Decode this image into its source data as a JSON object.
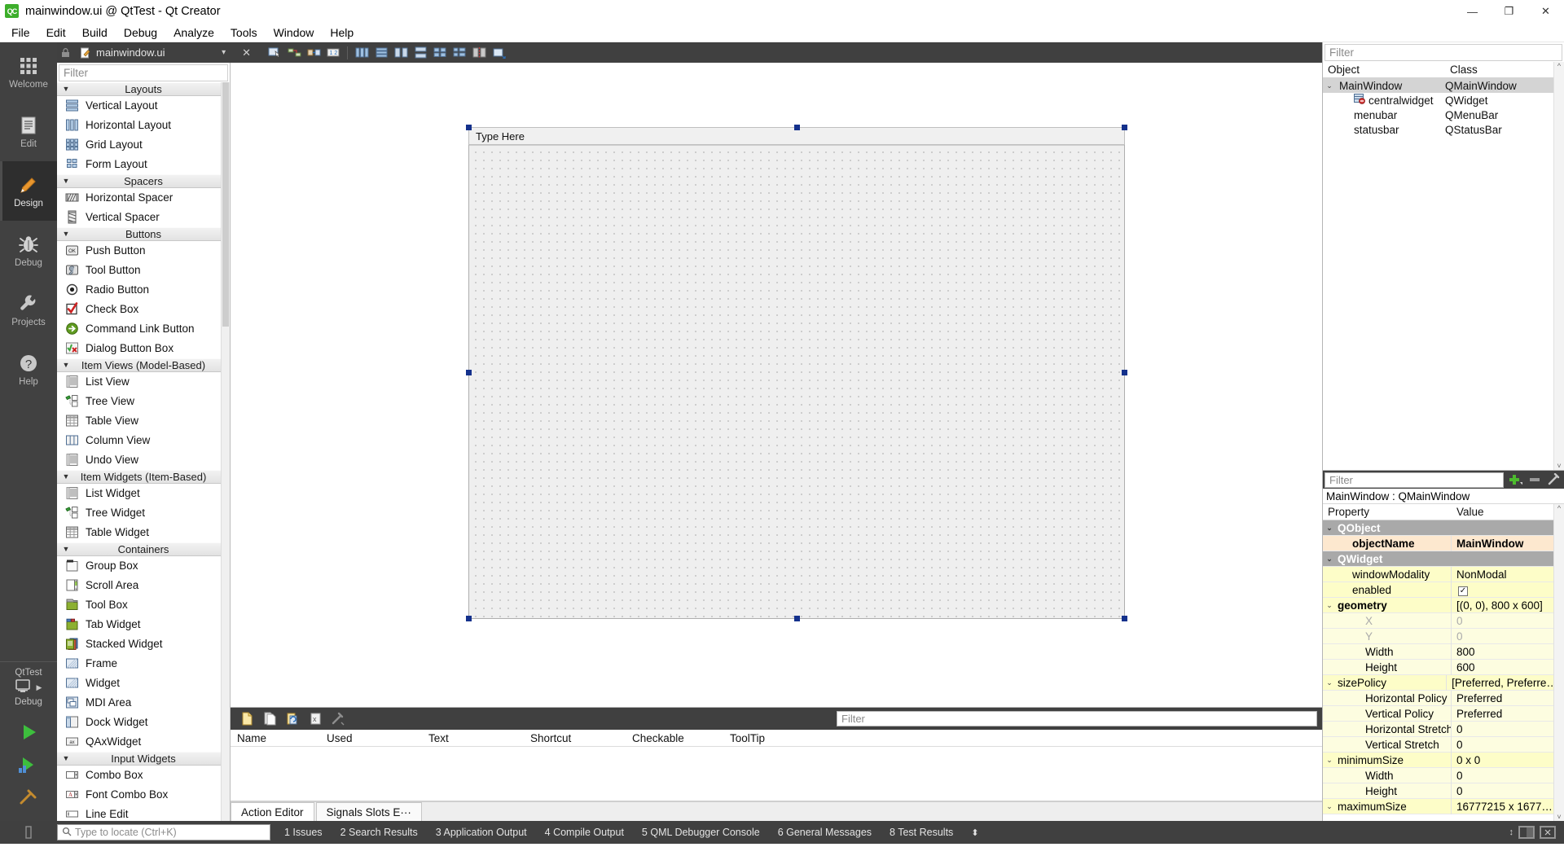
{
  "window": {
    "title": "mainwindow.ui @ QtTest - Qt Creator",
    "app_icon_label": "QC",
    "minimize": "—",
    "maximize": "❐",
    "close": "✕"
  },
  "menubar": {
    "items": [
      "File",
      "Edit",
      "Build",
      "Debug",
      "Analyze",
      "Tools",
      "Window",
      "Help"
    ]
  },
  "modebar": {
    "items": [
      {
        "label": "Welcome",
        "icon": "grid-icon",
        "active": false
      },
      {
        "label": "Edit",
        "icon": "document-icon",
        "active": false
      },
      {
        "label": "Design",
        "icon": "pencil-icon",
        "active": true
      },
      {
        "label": "Debug",
        "icon": "bug-icon",
        "active": false
      },
      {
        "label": "Projects",
        "icon": "wrench-icon",
        "active": false
      },
      {
        "label": "Help",
        "icon": "question-icon",
        "active": false
      }
    ],
    "kit": {
      "project": "QtTest",
      "config": "Debug"
    },
    "run_buttons": [
      "run-icon",
      "debug-run-icon",
      "build-icon"
    ]
  },
  "editor_tab": {
    "filename": "mainwindow.ui",
    "caret": "▾",
    "close": "✕",
    "toolbar_icons": [
      "edit-widgets-icon",
      "edit-signals-slots-icon",
      "edit-buddies-icon",
      "edit-tab-order-icon",
      "layout-horizontal-icon",
      "layout-vertical-icon",
      "layout-splitter-h-icon",
      "layout-splitter-v-icon",
      "layout-grid-icon",
      "layout-form-icon",
      "break-layout-icon",
      "adjust-size-icon"
    ]
  },
  "widget_box": {
    "filter_placeholder": "Filter",
    "categories": [
      {
        "name": "Layouts",
        "items": [
          {
            "label": "Vertical Layout",
            "icon": "vertical-layout-icon"
          },
          {
            "label": "Horizontal Layout",
            "icon": "horizontal-layout-icon"
          },
          {
            "label": "Grid Layout",
            "icon": "grid-layout-icon"
          },
          {
            "label": "Form Layout",
            "icon": "form-layout-icon"
          }
        ]
      },
      {
        "name": "Spacers",
        "items": [
          {
            "label": "Horizontal Spacer",
            "icon": "horizontal-spacer-icon"
          },
          {
            "label": "Vertical Spacer",
            "icon": "vertical-spacer-icon"
          }
        ]
      },
      {
        "name": "Buttons",
        "items": [
          {
            "label": "Push Button",
            "icon": "push-button-icon"
          },
          {
            "label": "Tool Button",
            "icon": "tool-button-icon"
          },
          {
            "label": "Radio Button",
            "icon": "radio-button-icon"
          },
          {
            "label": "Check Box",
            "icon": "check-box-icon"
          },
          {
            "label": "Command Link Button",
            "icon": "command-link-icon"
          },
          {
            "label": "Dialog Button Box",
            "icon": "dialog-button-box-icon"
          }
        ]
      },
      {
        "name": "Item Views (Model-Based)",
        "items": [
          {
            "label": "List View",
            "icon": "list-view-icon"
          },
          {
            "label": "Tree View",
            "icon": "tree-view-icon"
          },
          {
            "label": "Table View",
            "icon": "table-view-icon"
          },
          {
            "label": "Column View",
            "icon": "column-view-icon"
          },
          {
            "label": "Undo View",
            "icon": "undo-view-icon"
          }
        ]
      },
      {
        "name": "Item Widgets (Item-Based)",
        "items": [
          {
            "label": "List Widget",
            "icon": "list-widget-icon"
          },
          {
            "label": "Tree Widget",
            "icon": "tree-widget-icon"
          },
          {
            "label": "Table Widget",
            "icon": "table-widget-icon"
          }
        ]
      },
      {
        "name": "Containers",
        "items": [
          {
            "label": "Group Box",
            "icon": "group-box-icon"
          },
          {
            "label": "Scroll Area",
            "icon": "scroll-area-icon"
          },
          {
            "label": "Tool Box",
            "icon": "tool-box-icon"
          },
          {
            "label": "Tab Widget",
            "icon": "tab-widget-icon"
          },
          {
            "label": "Stacked Widget",
            "icon": "stacked-widget-icon"
          },
          {
            "label": "Frame",
            "icon": "frame-icon"
          },
          {
            "label": "Widget",
            "icon": "widget-icon"
          },
          {
            "label": "MDI Area",
            "icon": "mdi-area-icon"
          },
          {
            "label": "Dock Widget",
            "icon": "dock-widget-icon"
          },
          {
            "label": "QAxWidget",
            "icon": "qaxwidget-icon"
          }
        ]
      },
      {
        "name": "Input Widgets",
        "items": [
          {
            "label": "Combo Box",
            "icon": "combo-box-icon"
          },
          {
            "label": "Font Combo Box",
            "icon": "font-combo-box-icon"
          },
          {
            "label": "Line Edit",
            "icon": "line-edit-icon"
          }
        ]
      }
    ]
  },
  "form_canvas": {
    "menu_placeholder": "Type Here"
  },
  "action_editor": {
    "filter_placeholder": "Filter",
    "toolbar_icons": [
      "new-action-icon",
      "copy-action-icon",
      "paste-action-icon",
      "delete-action-icon",
      "configure-icon"
    ],
    "columns": [
      "Name",
      "Used",
      "Text",
      "Shortcut",
      "Checkable",
      "ToolTip"
    ],
    "rows": [],
    "tabs": [
      {
        "label": "Action Editor",
        "selected": true
      },
      {
        "label": "Signals  Slots E···",
        "selected": false
      }
    ]
  },
  "object_inspector": {
    "filter_placeholder": "Filter",
    "columns": [
      "Object",
      "Class"
    ],
    "rows": [
      {
        "object": "MainWindow",
        "class": "QMainWindow",
        "depth": 0,
        "twisty": "⌄",
        "selected": true,
        "icon": ""
      },
      {
        "object": "centralwidget",
        "class": "QWidget",
        "depth": 1,
        "twisty": "",
        "selected": false,
        "icon": "central-widget-icon"
      },
      {
        "object": "menubar",
        "class": "QMenuBar",
        "depth": 1,
        "twisty": "",
        "selected": false,
        "icon": ""
      },
      {
        "object": "statusbar",
        "class": "QStatusBar",
        "depth": 1,
        "twisty": "",
        "selected": false,
        "icon": ""
      }
    ]
  },
  "property_editor": {
    "filter_placeholder": "Filter",
    "buttons": [
      "add-property-icon",
      "remove-property-icon",
      "configure-icon"
    ],
    "object_header": "MainWindow : QMainWindow",
    "columns": [
      "Property",
      "Value"
    ],
    "rows": [
      {
        "property": "QObject",
        "value": "",
        "style": "group",
        "indent": 0,
        "twisty": "⌄"
      },
      {
        "property": "objectName",
        "value": "MainWindow",
        "style": "hl",
        "indent": 1,
        "twisty": ""
      },
      {
        "property": "QWidget",
        "value": "",
        "style": "group",
        "indent": 0,
        "twisty": "⌄"
      },
      {
        "property": "windowModality",
        "value": "NonModal",
        "style": "yellow",
        "indent": 1,
        "twisty": ""
      },
      {
        "property": "enabled",
        "value": "checkbox",
        "style": "yellow",
        "indent": 1,
        "twisty": ""
      },
      {
        "property": "geometry",
        "value": "[(0, 0), 800 x 600]",
        "style": "yellow",
        "indent": 0,
        "twisty": "⌄",
        "bold": true
      },
      {
        "property": "X",
        "value": "0",
        "style": "yellow2",
        "indent": 2,
        "twisty": "",
        "dim": true
      },
      {
        "property": "Y",
        "value": "0",
        "style": "yellow2",
        "indent": 2,
        "twisty": "",
        "dim": true
      },
      {
        "property": "Width",
        "value": "800",
        "style": "yellow2",
        "indent": 2,
        "twisty": ""
      },
      {
        "property": "Height",
        "value": "600",
        "style": "yellow2",
        "indent": 2,
        "twisty": ""
      },
      {
        "property": "sizePolicy",
        "value": "[Preferred, Preferre…",
        "style": "yellow",
        "indent": 0,
        "twisty": "⌄"
      },
      {
        "property": "Horizontal Policy",
        "value": "Preferred",
        "style": "yellow2",
        "indent": 2,
        "twisty": ""
      },
      {
        "property": "Vertical Policy",
        "value": "Preferred",
        "style": "yellow2",
        "indent": 2,
        "twisty": ""
      },
      {
        "property": "Horizontal Stretch",
        "value": "0",
        "style": "yellow2",
        "indent": 2,
        "twisty": ""
      },
      {
        "property": "Vertical Stretch",
        "value": "0",
        "style": "yellow2",
        "indent": 2,
        "twisty": ""
      },
      {
        "property": "minimumSize",
        "value": "0 x 0",
        "style": "yellow",
        "indent": 0,
        "twisty": "⌄"
      },
      {
        "property": "Width",
        "value": "0",
        "style": "yellow2",
        "indent": 2,
        "twisty": ""
      },
      {
        "property": "Height",
        "value": "0",
        "style": "yellow2",
        "indent": 2,
        "twisty": ""
      },
      {
        "property": "maximumSize",
        "value": "16777215 x 1677…",
        "style": "yellow",
        "indent": 0,
        "twisty": "⌄"
      }
    ]
  },
  "statusbar": {
    "locator_placeholder": "Type to locate (Ctrl+K)",
    "items": [
      "1 Issues",
      "2 Search Results",
      "3 Application Output",
      "4 Compile Output",
      "5 QML Debugger Console",
      "6 General Messages",
      "8 Test Results"
    ],
    "updown": "⬍"
  },
  "colors": {
    "dark_chrome": "#404040",
    "mode_active": "#2e2e2e",
    "selection_handle": "#14318c",
    "property_highlight": "#fde8cf",
    "property_yellow": "#fdfdc8",
    "accent_green": "#3dae2b"
  }
}
